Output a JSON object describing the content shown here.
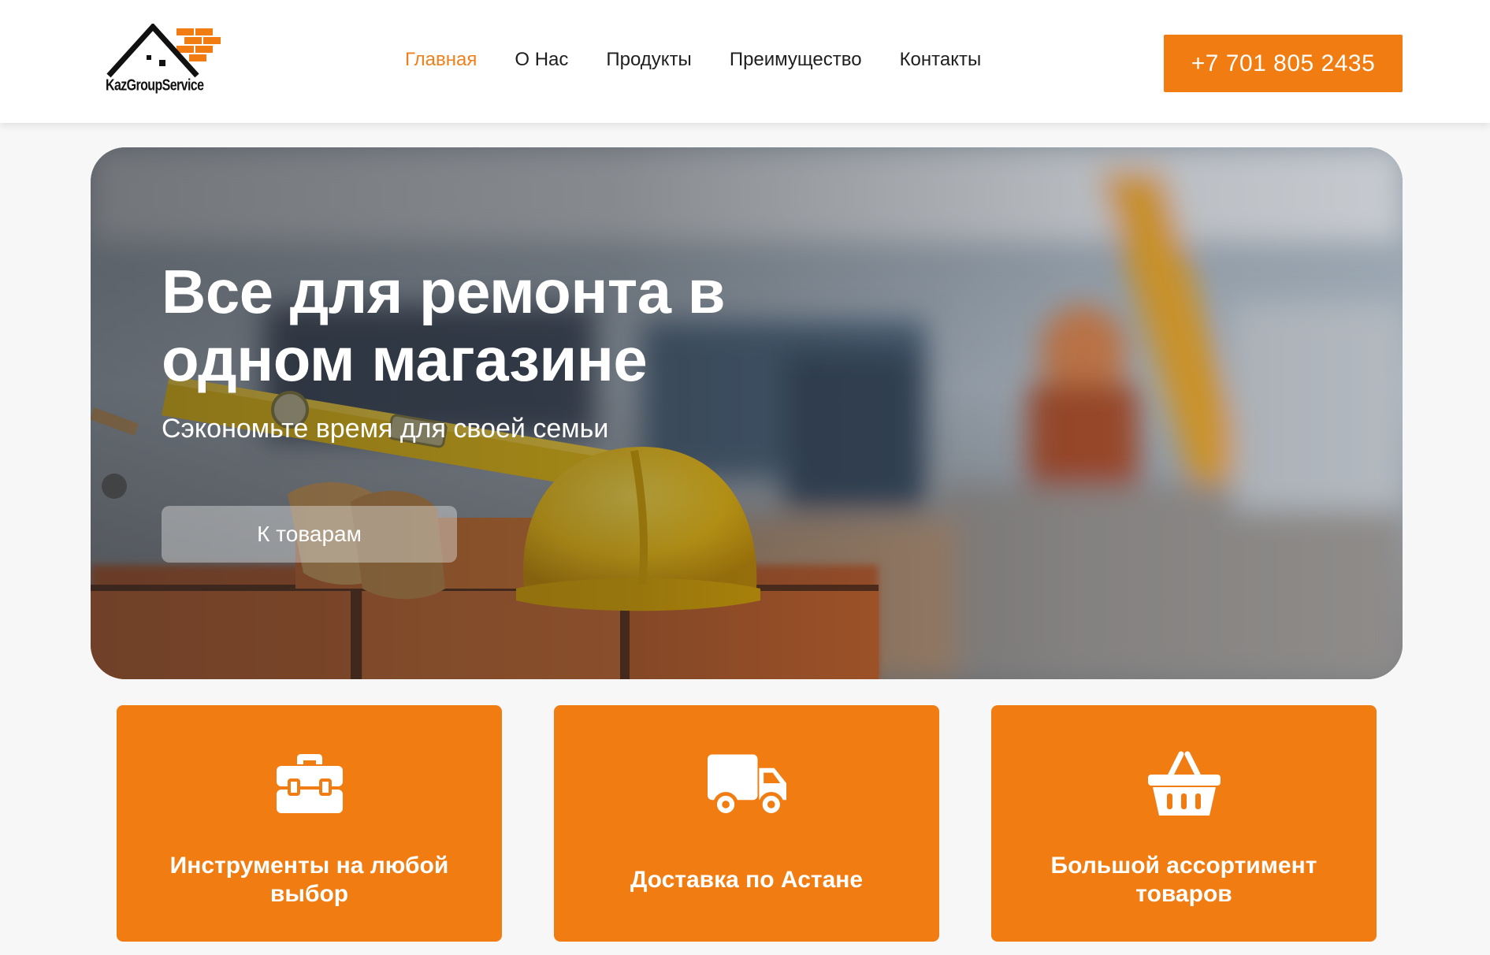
{
  "header": {
    "logo_text": "KazGroupService",
    "nav": [
      {
        "label": "Главная",
        "active": true
      },
      {
        "label": "О Нас",
        "active": false
      },
      {
        "label": "Продукты",
        "active": false
      },
      {
        "label": "Преимущество",
        "active": false
      },
      {
        "label": "Контакты",
        "active": false
      }
    ],
    "phone": "+7 701 805 2435"
  },
  "hero": {
    "title": "Все для ремонта в одном магазине",
    "subtitle": "Сэкономьте время для своей семьи",
    "button_label": "К товарам"
  },
  "features": [
    {
      "icon": "toolbox-icon",
      "title": "Инструменты на любой выбор"
    },
    {
      "icon": "truck-icon",
      "title": "Доставка по Астане"
    },
    {
      "icon": "basket-icon",
      "title": "Большой ассортимент товаров"
    }
  ],
  "colors": {
    "accent": "#f07c12",
    "nav_active": "#f0801a",
    "text_dark": "#1e1e1e",
    "page_background": "#f7f7f7"
  }
}
